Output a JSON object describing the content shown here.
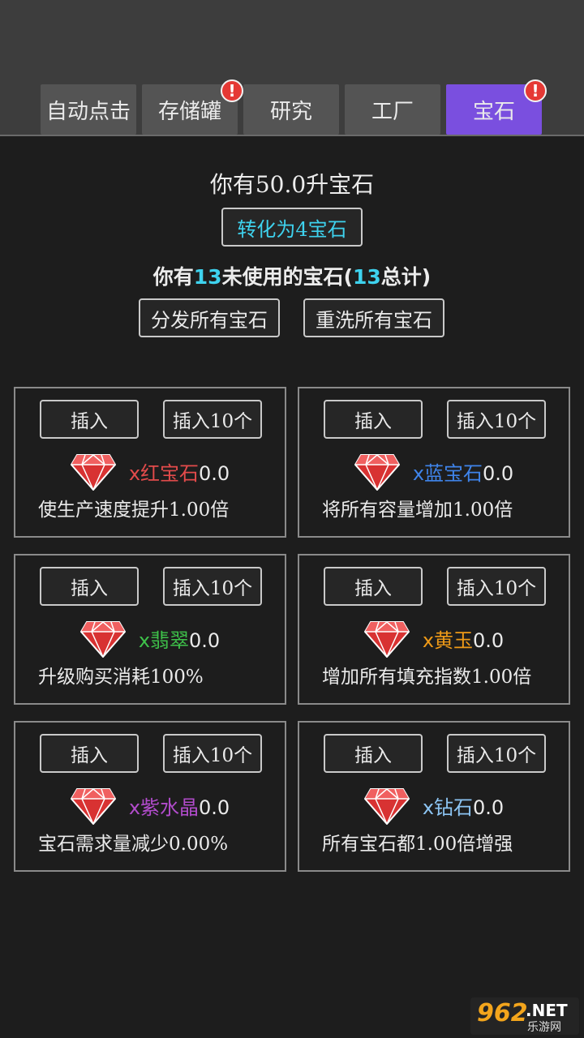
{
  "tabs": [
    {
      "label": "自动点击",
      "badge": ""
    },
    {
      "label": "存储罐",
      "badge": "!"
    },
    {
      "label": "研究",
      "badge": ""
    },
    {
      "label": "工厂",
      "badge": ""
    },
    {
      "label": "宝石",
      "badge": "!"
    }
  ],
  "active_tab": "宝石",
  "liters_line": "你有50.0升宝石",
  "convert_button": "转化为4宝石",
  "unused_line": {
    "prefix": "你有",
    "unused": "13",
    "middle": "未使用的宝石(",
    "total": "13",
    "suffix": "总计)"
  },
  "distribute_button": "分发所有宝石",
  "reset_button": "重洗所有宝石",
  "gems": [
    {
      "insert": "插入",
      "insert10": "插入10个",
      "name": "x红宝石",
      "count": "0.0",
      "color": "#e34b4b",
      "desc": "使生产速度提升1.00倍"
    },
    {
      "insert": "插入",
      "insert10": "插入10个",
      "name": "x蓝宝石",
      "count": "0.0",
      "color": "#3f84ea",
      "desc": "将所有容量增加1.00倍"
    },
    {
      "insert": "插入",
      "insert10": "插入10个",
      "name": "x翡翠",
      "count": "0.0",
      "color": "#3ec24a",
      "desc": "升级购买消耗100%"
    },
    {
      "insert": "插入",
      "insert10": "插入10个",
      "name": "x黄玉",
      "count": "0.0",
      "color": "#ee9a18",
      "desc": "增加所有填充指数1.00倍"
    },
    {
      "insert": "插入",
      "insert10": "插入10个",
      "name": "x紫水晶",
      "count": "0.0",
      "color": "#b24ccc",
      "desc": "宝石需求量减少0.00%"
    },
    {
      "insert": "插入",
      "insert10": "插入10个",
      "name": "x钻石",
      "count": "0.0",
      "color": "#8cc4f2",
      "desc": "所有宝石都1.00倍增强"
    }
  ],
  "watermark": {
    "number": "962",
    "net": ".NET",
    "sub": "乐游网"
  },
  "colors": {
    "accent": "#7a4fdf",
    "badge": "#e53935",
    "highlight": "#3ed2ee",
    "gem_red": "#d83232"
  }
}
